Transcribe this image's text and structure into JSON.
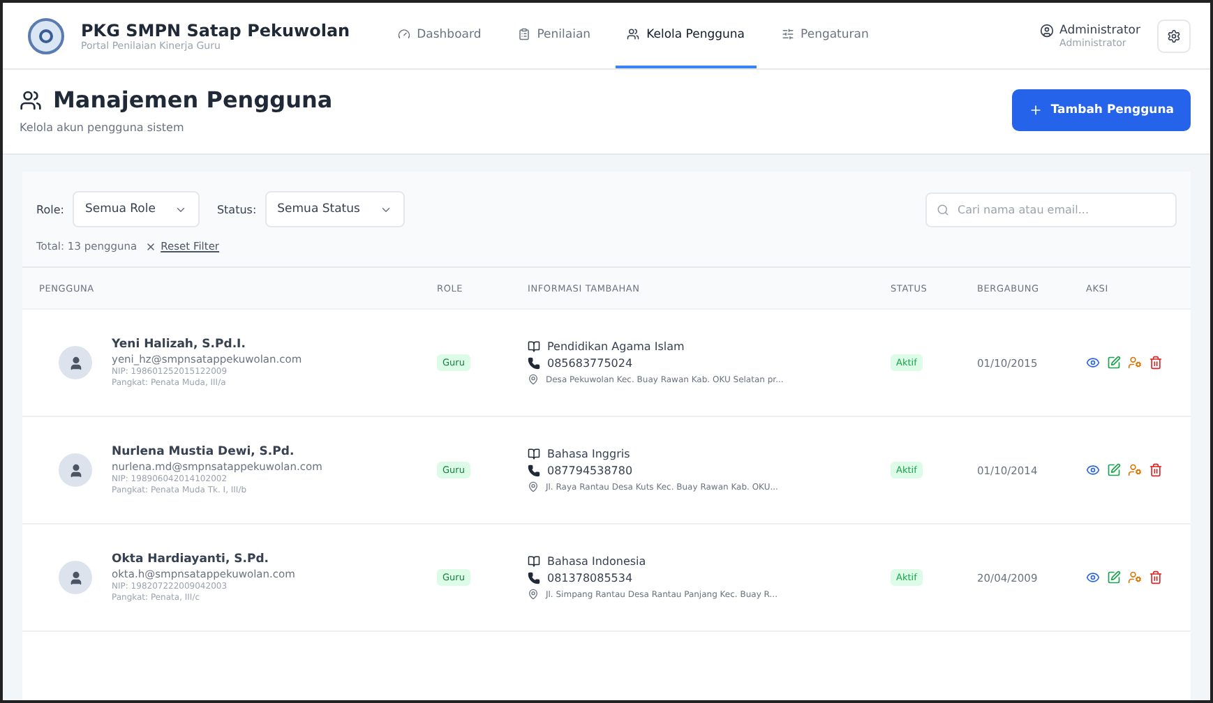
{
  "header": {
    "app_name": "PKG SMPN Satap Pekuwolan",
    "app_subtitle": "Portal Penilaian Kinerja Guru",
    "nav": [
      {
        "label": "Dashboard",
        "selected": false
      },
      {
        "label": "Penilaian",
        "selected": false
      },
      {
        "label": "Kelola Pengguna",
        "selected": true
      },
      {
        "label": "Pengaturan",
        "selected": false
      }
    ],
    "user": {
      "name": "Administrator",
      "role": "Administrator"
    }
  },
  "page": {
    "title": "Manajemen Pengguna",
    "subtitle": "Kelola akun pengguna sistem",
    "add_button": "Tambah Pengguna"
  },
  "filters": {
    "role_label": "Role:",
    "role_value": "Semua Role",
    "status_label": "Status:",
    "status_value": "Semua Status",
    "search": {
      "placeholder": "Cari nama atau email..."
    },
    "total": "Total: 13 pengguna",
    "reset": "Reset Filter"
  },
  "table": {
    "columns": [
      "PENGGUNA",
      "ROLE",
      "INFORMASI TAMBAHAN",
      "STATUS",
      "BERGABUNG",
      "AKSI"
    ],
    "rows": [
      {
        "name": "Yeni Halizah, S.Pd.I.",
        "email": "yeni_hz@smpnsatappekuwolan.com",
        "nip": "NIP: 198601252015122009",
        "rank": "Pangkat: Penata Muda, III/a",
        "role": "Guru",
        "subject": "Pendidikan Agama Islam",
        "phone": "085683775024",
        "address": "Desa Pekuwolan Kec. Buay Rawan Kab. OKU Selatan pr...",
        "status": "Aktif",
        "joined": "01/10/2015"
      },
      {
        "name": "Nurlena Mustia Dewi, S.Pd.",
        "email": "nurlena.md@smpnsatappekuwolan.com",
        "nip": "NIP: 198906042014102002",
        "rank": "Pangkat: Penata Muda Tk. I, III/b",
        "role": "Guru",
        "subject": "Bahasa Inggris",
        "phone": "087794538780",
        "address": "Jl. Raya Rantau Desa Kuts Kec. Buay Rawan Kab. OKU...",
        "status": "Aktif",
        "joined": "01/10/2014"
      },
      {
        "name": "Okta Hardiayanti, S.Pd.",
        "email": "okta.h@smpnsatappekuwolan.com",
        "nip": "NIP: 198207222009042003",
        "rank": "Pangkat: Penata, III/c",
        "role": "Guru",
        "subject": "Bahasa Indonesia",
        "phone": "081378085534",
        "address": "Jl. Simpang Rantau Desa Rantau Panjang Kec. Buay R...",
        "status": "Aktif",
        "joined": "20/04/2009"
      }
    ]
  }
}
